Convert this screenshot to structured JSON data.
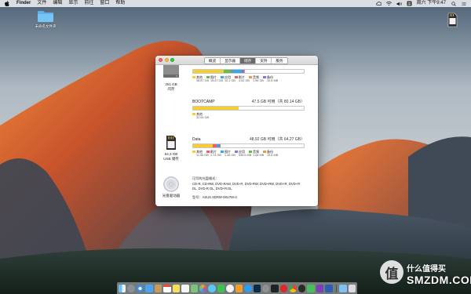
{
  "menubar": {
    "app_name": "Finder",
    "items": [
      "文件",
      "编辑",
      "显示",
      "前往",
      "窗口",
      "帮助"
    ],
    "clock": "周六 下午9:47"
  },
  "desktop": {
    "folder_label": "未命名文件夹"
  },
  "window": {
    "tabs": [
      {
        "label": "概览",
        "active": false
      },
      {
        "label": "显示器",
        "active": false
      },
      {
        "label": "储存",
        "active": true
      },
      {
        "label": "支持",
        "active": false
      },
      {
        "label": "服务",
        "active": false
      }
    ],
    "volumes": [
      {
        "icon": "hard-drive-icon",
        "caption_line1": "251 GB",
        "caption_line2": "闪存",
        "title": "",
        "free": "",
        "segments": [
          {
            "color": "#f4cf2f",
            "fraction": 0.28
          },
          {
            "color": "#5fc04a",
            "fraction": 0.06
          },
          {
            "color": "#f25a6e",
            "fraction": 0.01
          },
          {
            "color": "#37a8ea",
            "fraction": 0.09
          },
          {
            "color": "#8f6fd8",
            "fraction": 0.02
          },
          {
            "color": "#f09b3a",
            "fraction": 0.01
          }
        ],
        "legend": [
          {
            "color": "#f4cf2f",
            "label": "其他",
            "value": "38.87 GB"
          },
          {
            "color": "#5fc04a",
            "label": "图片",
            "value": "15.67 GB"
          },
          {
            "color": "#37a8ea",
            "label": "应用",
            "value": "10.1 GB"
          },
          {
            "color": "#f25a6e",
            "label": "影片",
            "value": "4.52 GB"
          },
          {
            "color": "#f09b3a",
            "label": "音频",
            "value": "1.96 GB"
          },
          {
            "color": "#8f6fd8",
            "label": "备份",
            "value": "10.6 MB"
          }
        ]
      },
      {
        "icon": "",
        "caption_line1": "",
        "caption_line2": "",
        "title": "BOOTCAMP",
        "free": "47.5 GB 可用（共 80.14 GB）",
        "segments": [
          {
            "color": "#f4cf2f",
            "fraction": 0.41
          }
        ],
        "legend": [
          {
            "color": "#f4cf2f",
            "label": "其他",
            "value": "32.64 GB"
          }
        ]
      },
      {
        "icon": "sd-card-icon",
        "caption_line1": "64.3 GB",
        "caption_line2": "USB 储存",
        "title": "Data",
        "free": "48.92 GB 可用（共 64.27 GB）",
        "segments": [
          {
            "color": "#f4cf2f",
            "fraction": 0.18
          },
          {
            "color": "#f25a6e",
            "fraction": 0.03
          },
          {
            "color": "#37a8ea",
            "fraction": 0.02
          },
          {
            "color": "#8f6fd8",
            "fraction": 0.01
          },
          {
            "color": "#5fc04a",
            "fraction": 0.01
          }
        ],
        "legend": [
          {
            "color": "#f4cf2f",
            "label": "其他",
            "value": "11.56 GB"
          },
          {
            "color": "#f25a6e",
            "label": "影片",
            "value": "1.74 GB"
          },
          {
            "color": "#37a8ea",
            "label": "图片",
            "value": "1.48 GB"
          },
          {
            "color": "#8f6fd8",
            "label": "应用",
            "value": "536.6 MB"
          },
          {
            "color": "#5fc04a",
            "label": "音频",
            "value": "1.08 MB"
          },
          {
            "color": "#f09b3a",
            "label": "备份",
            "value": "19.8 MB"
          }
        ]
      }
    ],
    "optical_drive": {
      "caption": "光盘驱动器",
      "heading": "可写的光盘格式：",
      "formats": "CD-R, CD-RW, DVD-RAM, DVD-R, DVD-RW, DVD+RW, DVD+R, DVD+R DL, DVD-R DL, DVD+R DL",
      "model": "型号：ASUS SDRW-08U7M-U"
    }
  },
  "watermark": {
    "badge_glyph": "值",
    "slogan": "什么值得买",
    "domain": "SMZDM.COM"
  }
}
